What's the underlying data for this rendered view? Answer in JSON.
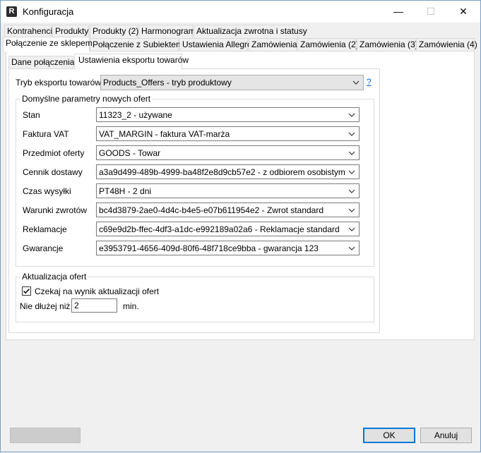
{
  "window": {
    "title": "Konfiguracja",
    "app_icon_letter": "R",
    "minimize_symbol": "—",
    "maximize_symbol": "☐",
    "close_symbol": "✕"
  },
  "tabs_row1": [
    {
      "label": "Kontrahenci"
    },
    {
      "label": "Produkty"
    },
    {
      "label": "Produkty (2)"
    },
    {
      "label": "Harmonogram"
    },
    {
      "label": "Aktualizacja zwrotna i statusy"
    }
  ],
  "tabs_row2": [
    {
      "label": "Połączenie ze sklepem",
      "active": true
    },
    {
      "label": "Połączenie z Subiektem"
    },
    {
      "label": "Ustawienia Allegro"
    },
    {
      "label": "Zamówienia"
    },
    {
      "label": "Zamówienia (2)"
    },
    {
      "label": "Zamówienia (3)"
    },
    {
      "label": "Zamówienia (4)"
    }
  ],
  "subtabs": [
    {
      "label": "Dane połączenia"
    },
    {
      "label": "Ustawienia eksportu towarów",
      "active": true
    }
  ],
  "export_mode": {
    "label": "Tryb eksportu towarów:",
    "value": "Products_Offers - tryb produktowy",
    "help": "?"
  },
  "defaults_group": {
    "title": "Domyślne parametry nowych ofert",
    "fields": [
      {
        "label": "Stan",
        "value": "11323_2 - używane"
      },
      {
        "label": "Faktura VAT",
        "value": "VAT_MARGIN - faktura VAT-marża"
      },
      {
        "label": "Przedmiot oferty",
        "value": "GOODS - Towar"
      },
      {
        "label": "Cennik dostawy",
        "value": "a3a9d499-489b-4999-ba48f2e8d9cb57e2 - z odbiorem osobistym"
      },
      {
        "label": "Czas wysyłki",
        "value": "PT48H - 2 dni"
      },
      {
        "label": "Warunki zwrotów",
        "value": "bc4d3879-2ae0-4d4c-b4e5-e07b611954e2 - Zwrot standard"
      },
      {
        "label": "Reklamacje",
        "value": "c69e9d2b-ffec-4df3-a1dc-e992189a02a6 - Reklamacje standard"
      },
      {
        "label": "Gwarancje",
        "value": "e3953791-4656-409d-80f6-48f718ce9bba - gwarancja 123"
      }
    ]
  },
  "update_group": {
    "title": "Aktualizacja ofert",
    "wait_checkbox": {
      "label": "Czekaj na wynik aktualizacji ofert",
      "checked": true
    },
    "limit_label": "Nie dłużej niż",
    "limit_value": "2",
    "limit_unit": "min."
  },
  "footer": {
    "ok_label": "OK",
    "cancel_label": "Anuluj"
  }
}
